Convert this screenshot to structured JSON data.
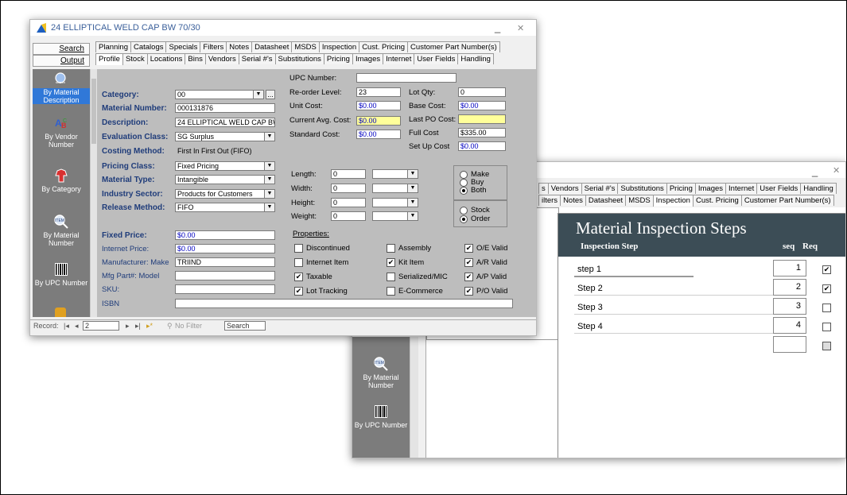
{
  "main": {
    "title": "24 ELLIPTICAL WELD CAP BW 70/30",
    "minimize": "_",
    "close": "✕",
    "search_label": "Search",
    "output_label": "Output",
    "tabs_top": [
      "Planning",
      "Catalogs",
      "Specials",
      "Filters",
      "Notes",
      "Datasheet",
      "MSDS",
      "Inspection",
      "Cust. Pricing",
      "Customer Part Number(s)"
    ],
    "tabs_bottom": [
      "Profile",
      "Stock",
      "Locations",
      "Bins",
      "Vendors",
      "Serial #'s",
      "Substitutions",
      "Pricing",
      "Images",
      "Internet",
      "User Fields",
      "Handling"
    ],
    "active_tab": "Profile",
    "sidebar": [
      {
        "label": "By Material Description",
        "icon": "search-icon",
        "selected": true
      },
      {
        "label": "By Vendor Number",
        "icon": "abc-icon",
        "selected": false
      },
      {
        "label": "By Category",
        "icon": "category-icon",
        "selected": false
      },
      {
        "label": "By Material Number",
        "icon": "magnifier-icon",
        "selected": false
      },
      {
        "label": "By UPC Number",
        "icon": "barcode-icon",
        "selected": false
      }
    ],
    "sidebar_search_text": "search",
    "form": {
      "category_label": "Category:",
      "category": "00",
      "category_btn": "...",
      "material_number_label": "Material Number:",
      "material_number": "000131876",
      "description_label": "Description:",
      "description": "24 ELLIPTICAL WELD CAP BW",
      "evaluation_class_label": "Evaluation Class:",
      "evaluation_class": "SG Surplus",
      "costing_method_label": "Costing Method:",
      "costing_method": "First In First Out (FIFO)",
      "pricing_class_label": "Pricing Class:",
      "pricing_class": "Fixed Pricing",
      "material_type_label": "Material Type:",
      "material_type": "Intangible",
      "industry_sector_label": "Industry Sector:",
      "industry_sector": "Products for Customers",
      "release_method_label": "Release Method:",
      "release_method": "FIFO",
      "fixed_price_label": "Fixed Price:",
      "fixed_price": "$0.00",
      "internet_price_label": "Internet Price:",
      "internet_price": "$0.00",
      "manufacturer_make_label": "Manufacturer: Make",
      "manufacturer_make": "TRIIND",
      "mfg_part_model_label": "Mfg Part#: Model",
      "mfg_part_model": "",
      "sku_label": "SKU:",
      "sku": "",
      "isbn_label": "ISBN",
      "isbn": "",
      "upc_label": "UPC Number:",
      "upc": "",
      "reorder_level_label": "Re-order Level:",
      "reorder_level": "23",
      "lot_qty_label": "Lot Qty:",
      "lot_qty": "0",
      "unit_cost_label": "Unit Cost:",
      "unit_cost": "$0.00",
      "base_cost_label": "Base Cost:",
      "base_cost": "$0.00",
      "current_avg_cost_label": "Current Avg. Cost:",
      "current_avg_cost": "$0.00",
      "last_po_cost_label": "Last PO Cost:",
      "last_po_cost": "",
      "standard_cost_label": "Standard Cost:",
      "standard_cost": "$0.00",
      "full_cost_label": "Full Cost",
      "full_cost": "$335.00",
      "setup_cost_label": "Set Up Cost",
      "setup_cost": "$0.00",
      "length_label": "Length:",
      "length": "0",
      "width_label": "Width:",
      "width": "0",
      "height_label": "Height:",
      "height": "0",
      "weight_label": "Weight:",
      "weight": "0",
      "make_label": "Make",
      "buy_label": "Buy",
      "both_label": "Both",
      "stock_label": "Stock",
      "order_label": "Order",
      "properties_label": "Properties:",
      "props": [
        {
          "label": "Discontinued",
          "checked": false
        },
        {
          "label": "Assembly",
          "checked": false
        },
        {
          "label": "O/E Valid",
          "checked": true
        },
        {
          "label": "Internet Item",
          "checked": false
        },
        {
          "label": "Kit Item",
          "checked": true
        },
        {
          "label": "A/R Valid",
          "checked": true
        },
        {
          "label": "Taxable",
          "checked": true
        },
        {
          "label": "Serialized/MIC",
          "checked": false
        },
        {
          "label": "A/P Valid",
          "checked": true
        },
        {
          "label": "Lot Tracking",
          "checked": true
        },
        {
          "label": "E-Commerce",
          "checked": false
        },
        {
          "label": "P/O Valid",
          "checked": true
        }
      ]
    },
    "status": {
      "record_label": "Record:",
      "first": "|◂",
      "prev": "◂",
      "record_value": "2",
      "next": "▸",
      "last": "▸|",
      "new": "▸*",
      "no_filter": "No Filter",
      "search": "Search"
    }
  },
  "second": {
    "minimize": "_",
    "close": "✕",
    "tabs_top": [
      "s",
      "Vendors",
      "Serial #'s",
      "Substitutions",
      "Pricing",
      "Images",
      "Internet",
      "User Fields",
      "Handling"
    ],
    "tabs_bottom": [
      "ilters",
      "Notes",
      "Datasheet",
      "MSDS",
      "Inspection",
      "Cust. Pricing",
      "Customer Part Number(s)"
    ],
    "active_tab": "Inspection",
    "sidebar": [
      {
        "label": "By Material Number",
        "icon": "magnifier-icon"
      },
      {
        "label": "By UPC Number",
        "icon": "barcode-icon"
      }
    ],
    "inspection": {
      "title": "Material Inspection Steps",
      "col_step": "Inspection Step",
      "col_seq": "seq",
      "col_req": "Req",
      "rows": [
        {
          "step": "step 1",
          "seq": "1",
          "req": true
        },
        {
          "step": "Step 2",
          "seq": "2",
          "req": true
        },
        {
          "step": "Step 3",
          "seq": "3",
          "req": false
        },
        {
          "step": "Step 4",
          "seq": "4",
          "req": false
        }
      ]
    }
  }
}
